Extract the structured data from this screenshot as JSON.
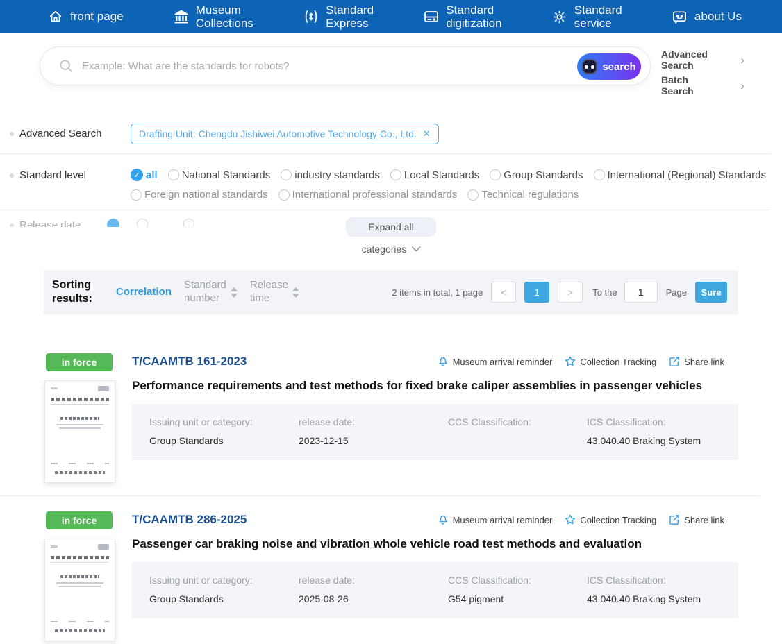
{
  "nav": {
    "items": [
      {
        "label": "front page"
      },
      {
        "label": "Museum\nCollections"
      },
      {
        "label": "Standard\nExpress"
      },
      {
        "label": "Standard\ndigitization"
      },
      {
        "label": "Standard\nservice"
      },
      {
        "label": "about Us"
      }
    ]
  },
  "search": {
    "placeholder": "Example: What are the standards for robots?",
    "button_label": "search",
    "advanced_label": "Advanced\nSearch",
    "batch_label": "Batch\nSearch"
  },
  "icons": {
    "check": "✓",
    "close": "✕",
    "chevron_right": "›"
  },
  "filters": {
    "advanced_search_label": "Advanced Search",
    "filter_tag": "Drafting Unit: Chengdu Jishiwei Automotive Technology Co., Ltd.",
    "standard_level_label": "Standard level",
    "level_options_row1": [
      "all",
      "National Standards",
      "industry standards",
      "Local Standards",
      "Group Standards",
      "International (Regional) Standards"
    ],
    "level_options_row2": [
      "Foreign national standards",
      "International professional standards",
      "Technical regulations"
    ],
    "selected_level": "all",
    "release_date_label": "Release date",
    "expand_all_label": "Expand all",
    "categories_label": "categories"
  },
  "sorting": {
    "label": "Sorting\nresults:",
    "correlation": "Correlation",
    "standard_number": "Standard\nnumber",
    "release_time": "Release\ntime",
    "active": "Correlation",
    "total_text": "2 items in total, 1 page",
    "prev": "<",
    "current_page": "1",
    "next": ">",
    "to_the": "To the",
    "page_input": "1",
    "page_word": "Page",
    "sure": "Sure"
  },
  "results": [
    {
      "status": "in force",
      "number": "T/CAAMTB 161-2023",
      "title": "Performance requirements and test methods for fixed brake caliper assemblies in passenger vehicles",
      "actions": [
        "Museum arrival reminder",
        "Collection Tracking",
        "Share link"
      ],
      "meta": [
        {
          "label": "Issuing unit or category:",
          "value": "Group Standards"
        },
        {
          "label": "release date:",
          "value": "2023-12-15"
        },
        {
          "label": "CCS Classification:",
          "value": ""
        },
        {
          "label": "ICS Classification:",
          "value": "43.040.40 Braking System"
        }
      ]
    },
    {
      "status": "in force",
      "number": "T/CAAMTB 286-2025",
      "title": "Passenger car braking noise and vibration whole vehicle road test methods and evaluation",
      "actions": [
        "Museum arrival reminder",
        "Collection Tracking",
        "Share link"
      ],
      "meta": [
        {
          "label": "Issuing unit or category:",
          "value": "Group Standards"
        },
        {
          "label": "release date:",
          "value": "2025-08-26"
        },
        {
          "label": "CCS Classification:",
          "value": "G54 pigment"
        },
        {
          "label": "ICS Classification:",
          "value": "43.040.40 Braking System"
        }
      ]
    }
  ],
  "colors": {
    "nav_blue": "#0d63b5",
    "accent_blue": "#3fa7e0",
    "link_blue": "#2e9ee2",
    "tag_blue": "#54a7e4",
    "badge_green": "#55b957",
    "number_navy": "#1d5091",
    "gradient_start": "#2f7ef2",
    "gradient_end": "#7b31ee"
  }
}
